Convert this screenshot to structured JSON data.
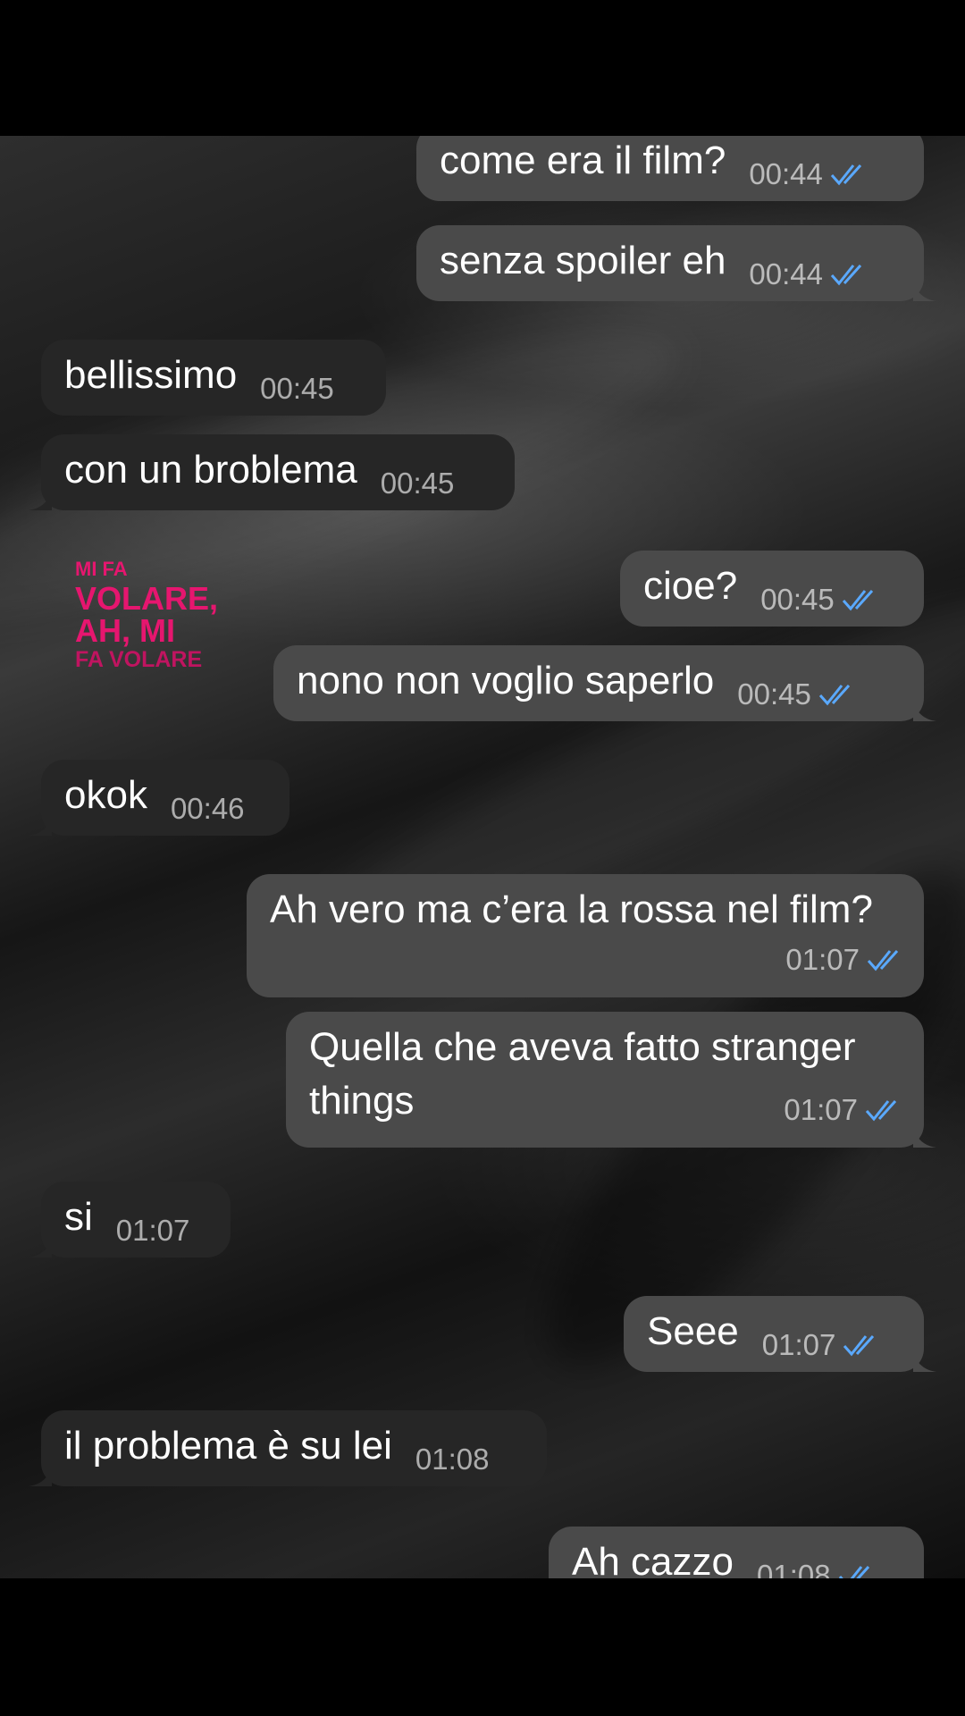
{
  "conversation": {
    "sticker": {
      "lines": [
        "MI FA",
        "VOLARE,",
        "AH, MI",
        "FA VOLARE"
      ],
      "color": "#e6166f"
    },
    "messages": [
      {
        "text": "come era il film?",
        "time": "00:44",
        "direction": "outgoing",
        "read": true
      },
      {
        "text": "senza spoiler eh",
        "time": "00:44",
        "direction": "outgoing",
        "read": true
      },
      {
        "text": "bellissimo",
        "time": "00:45",
        "direction": "incoming"
      },
      {
        "text": "con un broblema",
        "time": "00:45",
        "direction": "incoming"
      },
      {
        "text": "cioe?",
        "time": "00:45",
        "direction": "outgoing",
        "read": true
      },
      {
        "text": "nono non voglio saperlo",
        "time": "00:45",
        "direction": "outgoing",
        "read": true
      },
      {
        "text": "okok",
        "time": "00:46",
        "direction": "incoming"
      },
      {
        "text": "Ah vero ma c’era la rossa nel film?",
        "time": "01:07",
        "direction": "outgoing",
        "read": true
      },
      {
        "text": "Quella che aveva fatto stranger things",
        "time": "01:07",
        "direction": "outgoing",
        "read": true
      },
      {
        "text": "si",
        "time": "01:07",
        "direction": "incoming"
      },
      {
        "text": "Seee",
        "time": "01:07",
        "direction": "outgoing",
        "read": true
      },
      {
        "text": "il problema è su lei",
        "time": "01:08",
        "direction": "incoming"
      },
      {
        "text": "Ah cazzo",
        "time": "01:08",
        "direction": "outgoing",
        "read": true
      }
    ]
  },
  "colors": {
    "outgoing_bubble": "#4a4a4a",
    "incoming_bubble": "#262626",
    "read_ticks": "#5aa9ff"
  }
}
